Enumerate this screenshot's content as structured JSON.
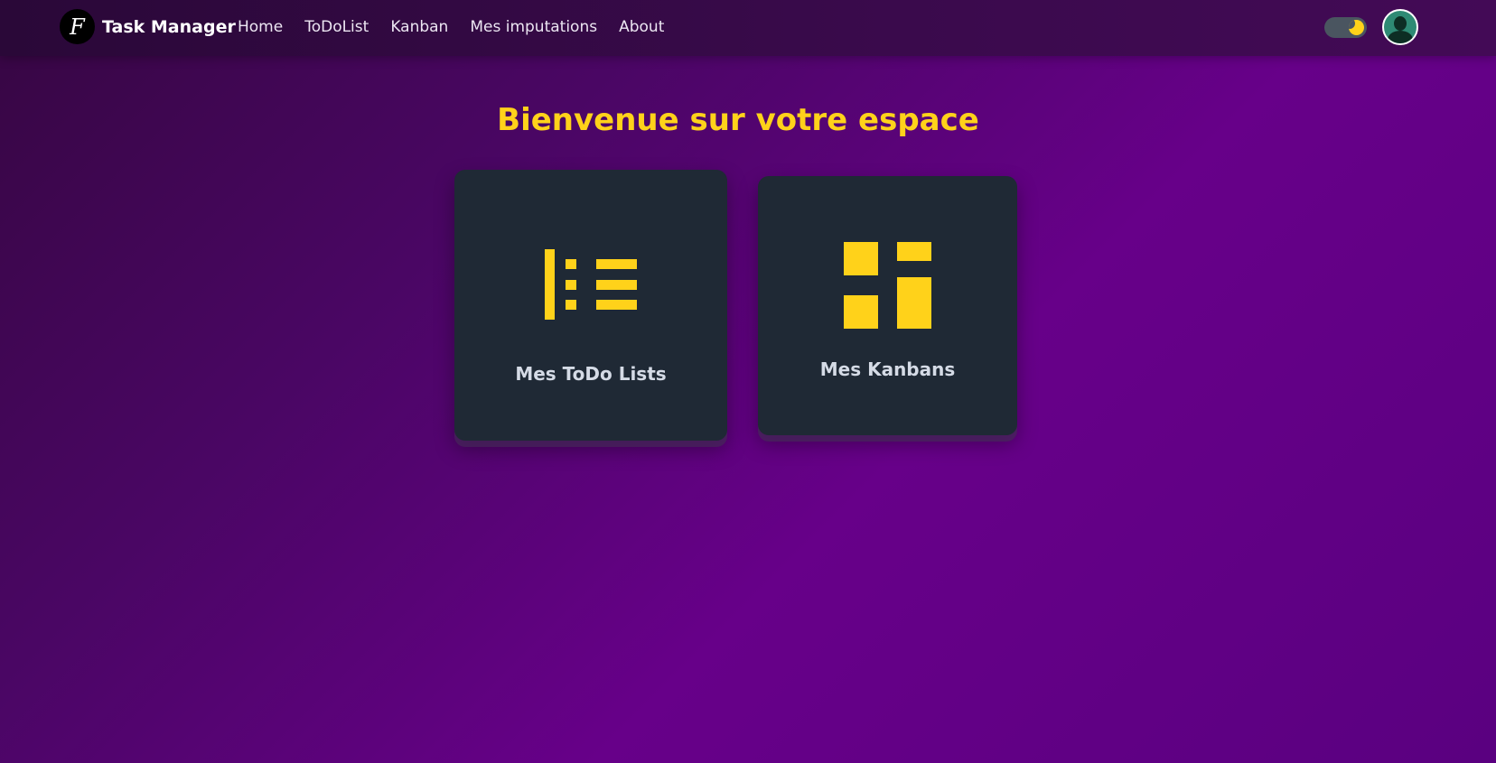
{
  "app": {
    "logo_letter": "F",
    "brand": "Task Manager"
  },
  "nav": {
    "links": [
      {
        "label": "Home"
      },
      {
        "label": "ToDoList"
      },
      {
        "label": "Kanban"
      },
      {
        "label": "Mes imputations"
      },
      {
        "label": "About"
      }
    ]
  },
  "header_right": {
    "theme_toggle_icon": "moon-icon",
    "avatar_icon": "user-avatar-icon"
  },
  "main": {
    "title": "Bienvenue sur votre espace",
    "cards": [
      {
        "label": "Mes ToDo Lists",
        "icon": "list-icon"
      },
      {
        "label": "Mes Kanbans",
        "icon": "kanban-icon"
      }
    ]
  },
  "colors": {
    "accent": "#ffd21a",
    "card_bg": "#1f2935",
    "background": "#5a0080"
  }
}
